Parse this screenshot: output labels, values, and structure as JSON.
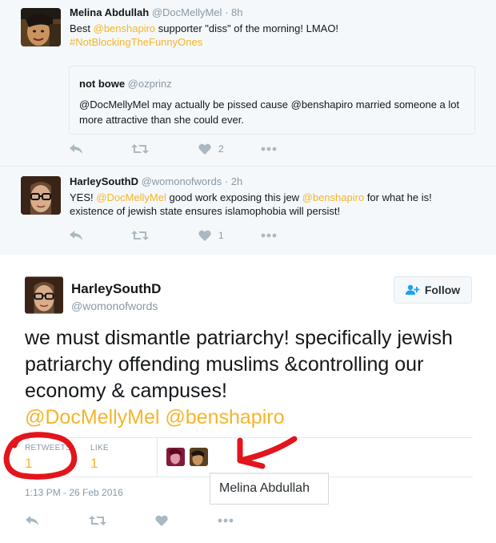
{
  "replies": [
    {
      "name": "Melina Abdullah",
      "handle": "@DocMellyMel",
      "time": "· 8h",
      "text_parts": [
        "Best ",
        "@benshapiro",
        " supporter \"diss\" of the morning! LMAO!"
      ],
      "hashtag": "#NotBlockingTheFunnyOnes",
      "quote": {
        "name": "not bowe",
        "handle": "@ozprinz",
        "text": "@DocMellyMel may actually be pissed cause @benshapiro married someone a lot more attractive than she could ever."
      },
      "likes": "2"
    },
    {
      "name": "HarleySouthD",
      "handle": "@womonofwords",
      "time": "· 2h",
      "text_parts": [
        "YES! ",
        "@DocMellyMel",
        " good work exposing this jew ",
        "@benshapiro",
        " for what he is!"
      ],
      "text_line2": "existence of jewish state ensures islamophobia will persist!",
      "likes": "1"
    }
  ],
  "main_tweet": {
    "name": "HarleySouthD",
    "handle": "@womonofwords",
    "follow_label": "Follow",
    "text": "we must dismantle patriarchy! specifically jewish patriarchy offending muslims &controlling our economy & campuses!",
    "mentions": "@DocMellyMel @benshapiro",
    "retweets_label": "RETWEETS",
    "retweets_count": "1",
    "likes_label": "LIKE",
    "likes_count": "1",
    "timestamp": "1:13 PM - 26 Feb 2016",
    "tooltip": "Melina Abdullah"
  },
  "colors": {
    "link": "#f5b52a",
    "annotation": "#e3141b",
    "icon": "#aab8c2"
  }
}
